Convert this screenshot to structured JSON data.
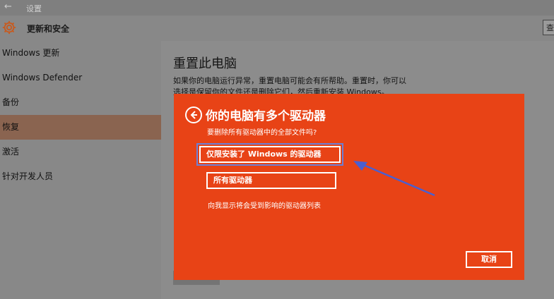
{
  "window": {
    "back_glyph": "←",
    "title": "设置"
  },
  "header": {
    "section_title": "更新和安全",
    "search_glyph": "查"
  },
  "sidebar": {
    "items": [
      {
        "label": "Windows 更新"
      },
      {
        "label": "Windows Defender"
      },
      {
        "label": "备份"
      },
      {
        "label": "恢复",
        "active": true
      },
      {
        "label": "激活"
      },
      {
        "label": "针对开发人员"
      }
    ]
  },
  "main": {
    "heading": "重置此电脑",
    "description": "如果你的电脑运行异常，重置电脑可能会有所帮助。重置时，你可以选择是保留你的文件还是删除它们，然后重新安装 Windows。"
  },
  "dialog": {
    "title": "你的电脑有多个驱动器",
    "question": "要删除所有驱动器中的全部文件吗?",
    "option_windows_drive": "仅限安装了 Windows 的驱动器",
    "option_all_drives": "所有驱动器",
    "show_affected_link": "向我显示将会受到影响的驱动器列表",
    "cancel_label": "取消",
    "colors": {
      "background": "#e84316",
      "highlight_frame": "#6b7fd6",
      "annotation_arrow": "#4a5fd0"
    }
  },
  "icons": {
    "gear": "gear-icon",
    "back": "back-arrow-icon",
    "annotation": "arrow-annotation-icon"
  }
}
